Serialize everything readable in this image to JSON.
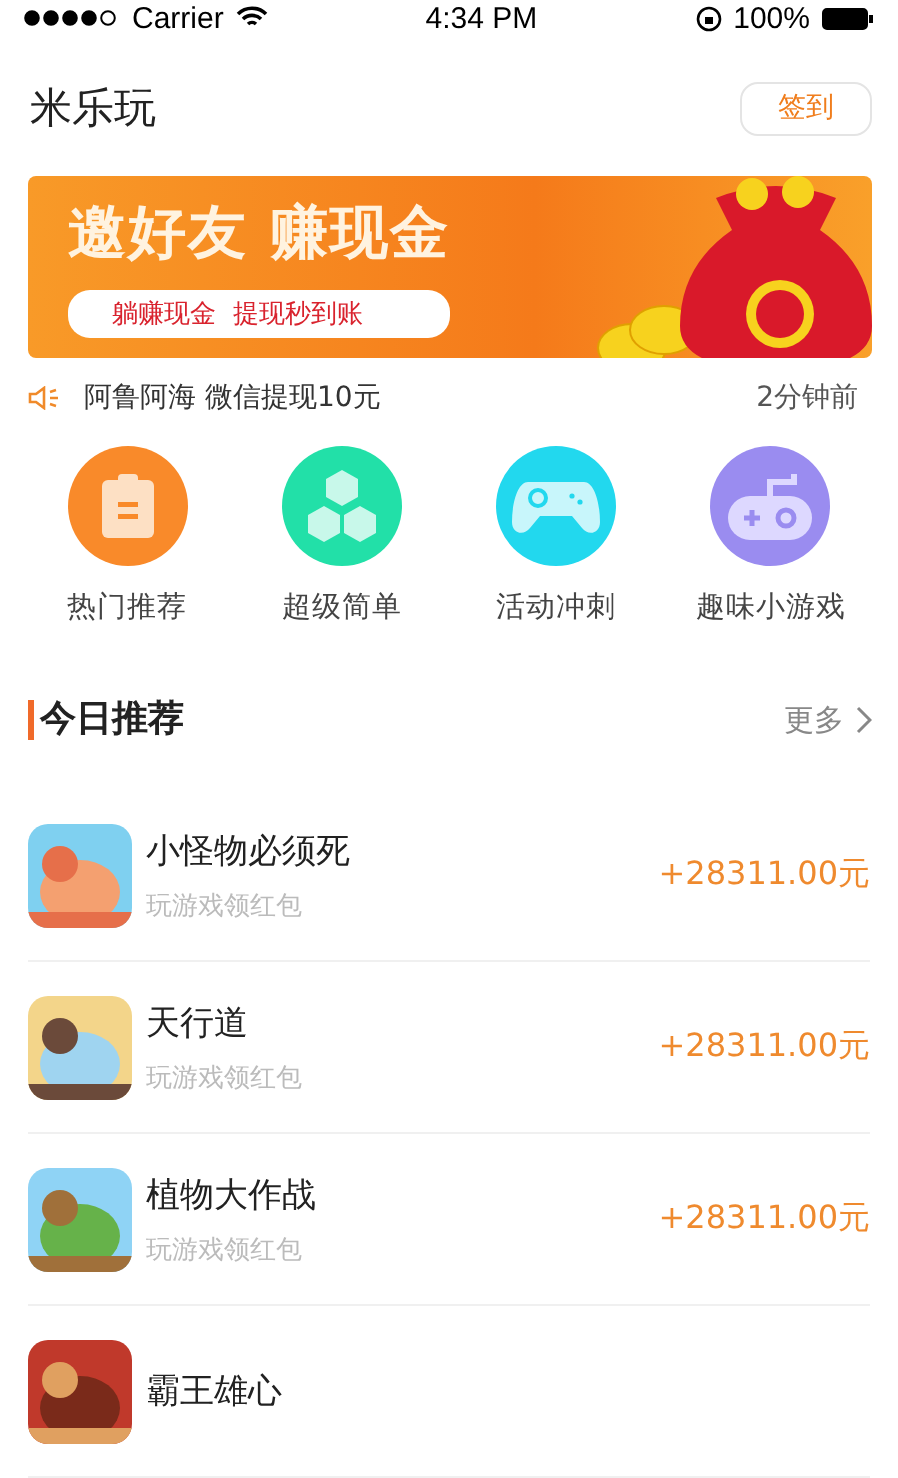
{
  "status_bar": {
    "carrier": "Carrier",
    "time": "4:34 PM",
    "battery": "100%"
  },
  "header": {
    "title": "米乐玩",
    "sign_in": "签到"
  },
  "banner": {
    "headline": "邀好友 赚现金",
    "tagline": "躺赚现金  提现秒到账"
  },
  "ticker": {
    "message": "阿鲁阿海 微信提现10元",
    "time": "2分钟前"
  },
  "categories": [
    {
      "label": "热门推荐",
      "kind": "clipboard",
      "color": "#f98a2a"
    },
    {
      "label": "超级简单",
      "kind": "hexagons",
      "color": "#22e0a8"
    },
    {
      "label": "活动冲刺",
      "kind": "gamepad",
      "color": "#22d8ee"
    },
    {
      "label": "趣味小游戏",
      "kind": "joystick",
      "color": "#9a8cf0"
    }
  ],
  "section": {
    "title": "今日推荐",
    "more": "更多"
  },
  "games": [
    {
      "name": "小怪物必须死",
      "subtitle": "玩游戏领红包",
      "reward": "+28311.00元"
    },
    {
      "name": "天行道",
      "subtitle": "玩游戏领红包",
      "reward": "+28311.00元"
    },
    {
      "name": "植物大作战",
      "subtitle": "玩游戏领红包",
      "reward": "+28311.00元"
    },
    {
      "name": "霸王雄心"
    }
  ]
}
